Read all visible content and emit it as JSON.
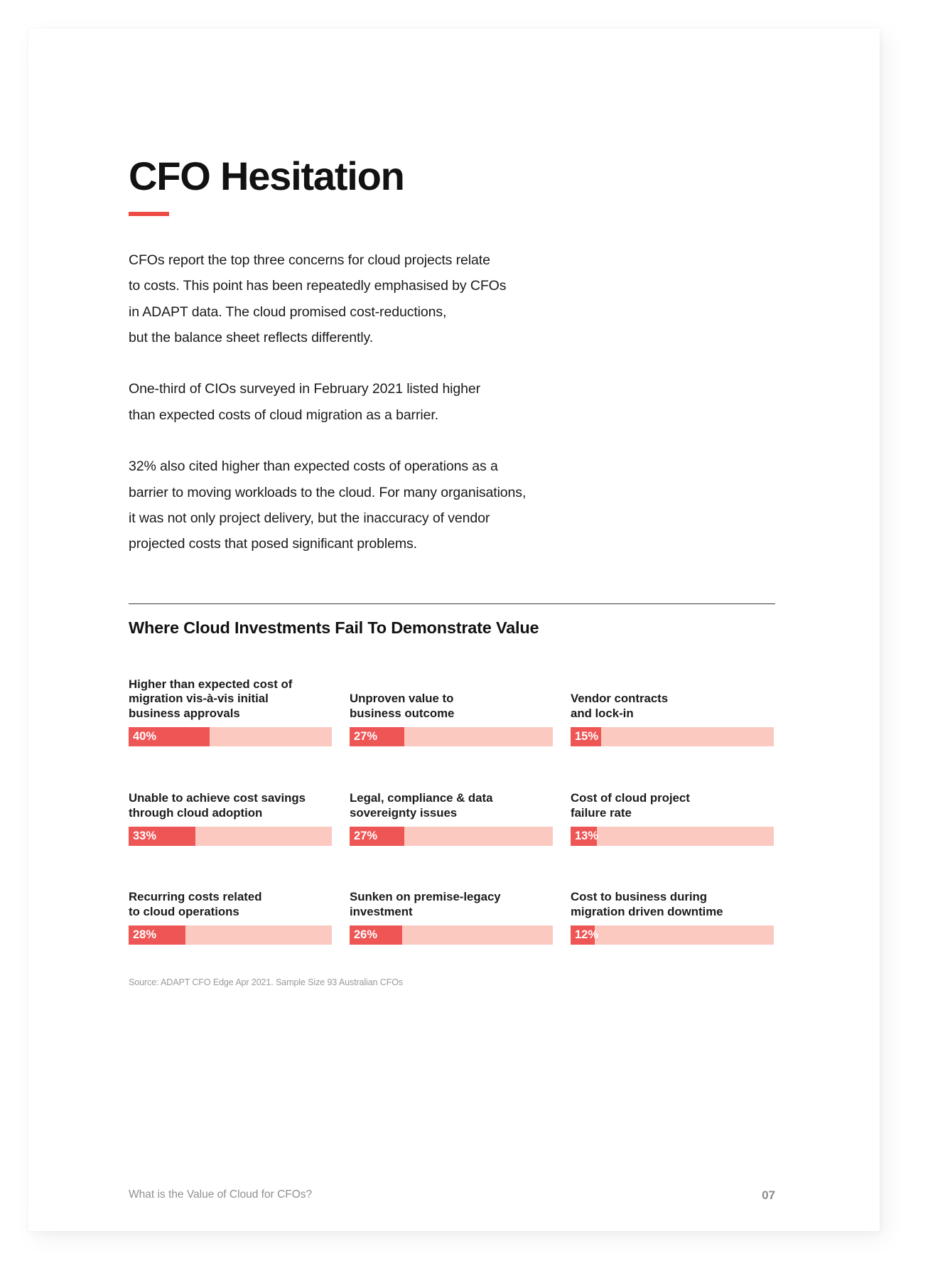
{
  "page": {
    "title": "CFO Hesitation",
    "accent_color": "#EE4B45",
    "paragraphs": [
      "CFOs report the top three concerns for cloud projects relate\nto costs. This point has been repeatedly emphasised by CFOs\nin ADAPT data. The cloud promised cost-reductions,\nbut the balance sheet reflects differently.",
      "One-third of CIOs surveyed in February 2021 listed higher\nthan expected costs of cloud migration as a barrier.",
      "32% also cited higher than expected costs of operations as a\nbarrier to moving workloads to the cloud. For many organisations,\nit was not only project delivery, but the inaccuracy of vendor\nprojected costs that posed significant problems."
    ],
    "source": "Source: ADAPT CFO Edge Apr 2021. Sample Size 93 Australian CFOs",
    "footer_title": "What is the Value of Cloud for CFOs?",
    "page_number": "07"
  },
  "chart_data": {
    "type": "bar",
    "orientation": "horizontal",
    "title": "Where Cloud Investments Fail To Demonstrate Value",
    "xlabel": "",
    "ylabel": "",
    "xlim": [
      0,
      100
    ],
    "unit": "%",
    "layout": "3x3 grid of single-bar panels",
    "colors": {
      "fill": "#EE5555",
      "track": "#FCC9C1",
      "value_label": "#FFFFFF"
    },
    "categories": [
      "Higher than expected cost of\nmigration vis-à-vis initial\nbusiness approvals",
      "Unproven value to\nbusiness outcome",
      "Vendor contracts\nand lock-in",
      "Unable to achieve cost savings\nthrough cloud adoption",
      "Legal, compliance & data\nsovereignty issues",
      "Cost of cloud project\nfailure rate",
      "Recurring costs related\nto cloud operations",
      "Sunken on premise-legacy\ninvestment",
      "Cost to business during\nmigration driven downtime"
    ],
    "values": [
      40,
      27,
      15,
      33,
      27,
      13,
      28,
      26,
      12
    ],
    "value_labels": [
      "40%",
      "27%",
      "15%",
      "33%",
      "27%",
      "13%",
      "28%",
      "26%",
      "12%"
    ]
  }
}
